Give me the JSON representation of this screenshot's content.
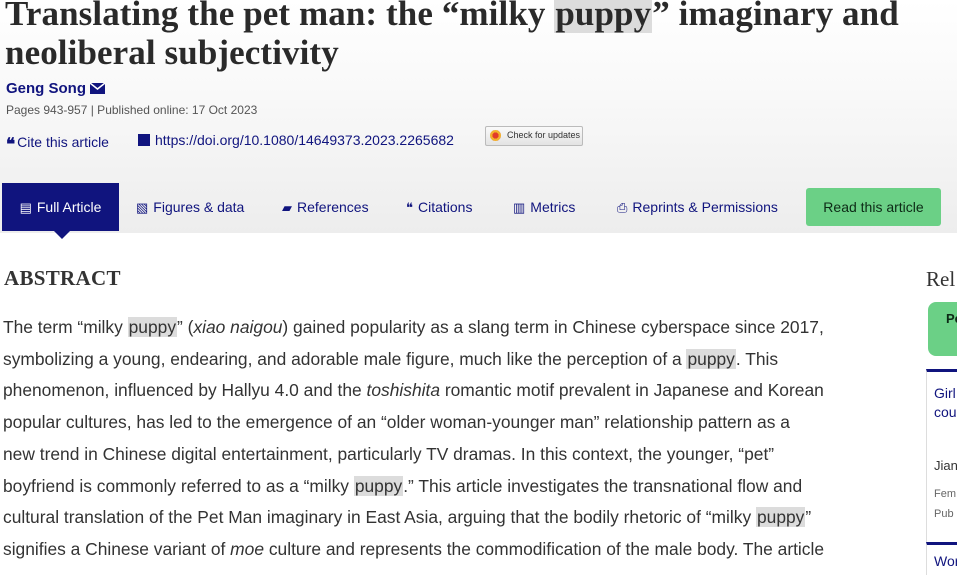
{
  "article": {
    "title_pre": "Translating the pet man: the “milky ",
    "title_hl": "puppy",
    "title_post": "” imaginary and neoliberal subjectivity",
    "author": "Geng Song",
    "meta": "Pages 943-957 | Published online: 17 Oct 2023",
    "cite_label": "Cite this article",
    "doi": "https://doi.org/10.1080/14649373.2023.2265682",
    "updates_label": "Check for updates"
  },
  "tabs": [
    {
      "label": "Full Article",
      "icon": "document-icon"
    },
    {
      "label": "Figures & data",
      "icon": "image-icon"
    },
    {
      "label": "References",
      "icon": "book-icon"
    },
    {
      "label": "Citations",
      "icon": "quote-icon"
    },
    {
      "label": "Metrics",
      "icon": "bar-chart-icon"
    },
    {
      "label": "Reprints & Permissions",
      "icon": "print-icon"
    }
  ],
  "read_button": "Read this article",
  "abstract": {
    "heading": "ABSTRACT",
    "lines": [
      [
        "The term “milky ",
        "puppy",
        "” (",
        "xiao naigou",
        ") gained popularity as a slang term in Chinese cyberspace since 2017,"
      ],
      [
        "symbolizing a young, endearing, and adorable male figure, much like the perception of a ",
        "puppy",
        ". This"
      ],
      [
        "phenomenon, influenced by Hallyu 4.0 and the ",
        "toshishita",
        " romantic motif prevalent in Japanese and Korean"
      ],
      [
        "popular cultures, has led to the emergence of an “older woman-younger man” relationship pattern as a"
      ],
      [
        "new trend in Chinese digital entertainment, particularly TV dramas. In this context, the younger, “pet”"
      ],
      [
        "boyfriend is commonly referred to as a “milky ",
        "puppy",
        ".” This article investigates the transnational flow and"
      ],
      [
        "cultural translation of the Pet Man imaginary in East Asia, arguing that the bodily rhetoric of “milky ",
        "puppy",
        "”"
      ],
      [
        "signifies a Chinese variant of ",
        "moe",
        " culture and represents the commodification of the male body. The article"
      ]
    ]
  },
  "sidebar": {
    "heading": "Rel",
    "green": "Pe",
    "card1_title": "Girl\ncou",
    "card1_author": "Jian",
    "card1_meta": "Fem\nPub",
    "card2_title": "Wor"
  }
}
